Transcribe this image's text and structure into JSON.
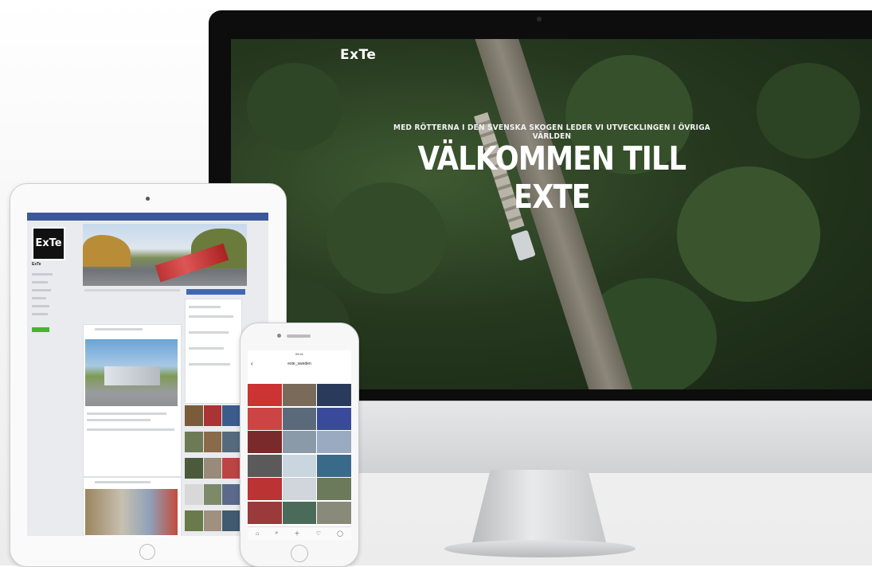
{
  "imac": {
    "logo": "ExTe",
    "subtitle": "MED RÖTTERNA I DEN SVENSKA SKOGEN LEDER VI UTVECKLINGEN I ÖVRIGA VÄRLDEN",
    "title": "VÄLKOMMEN TILL EXTE"
  },
  "ipad": {
    "app": "facebook",
    "profile_logo": "ExTe",
    "page_name": "ExTe"
  },
  "iphone": {
    "app": "instagram",
    "username": "exte_sweden",
    "status_time": "09:41"
  },
  "colors": {
    "facebook_blue": "#3b5998",
    "facebook_button": "#4267b2",
    "facebook_green": "#42b72a",
    "forest_dark": "#1f3019",
    "imac_bezel": "#0d0d0d"
  }
}
